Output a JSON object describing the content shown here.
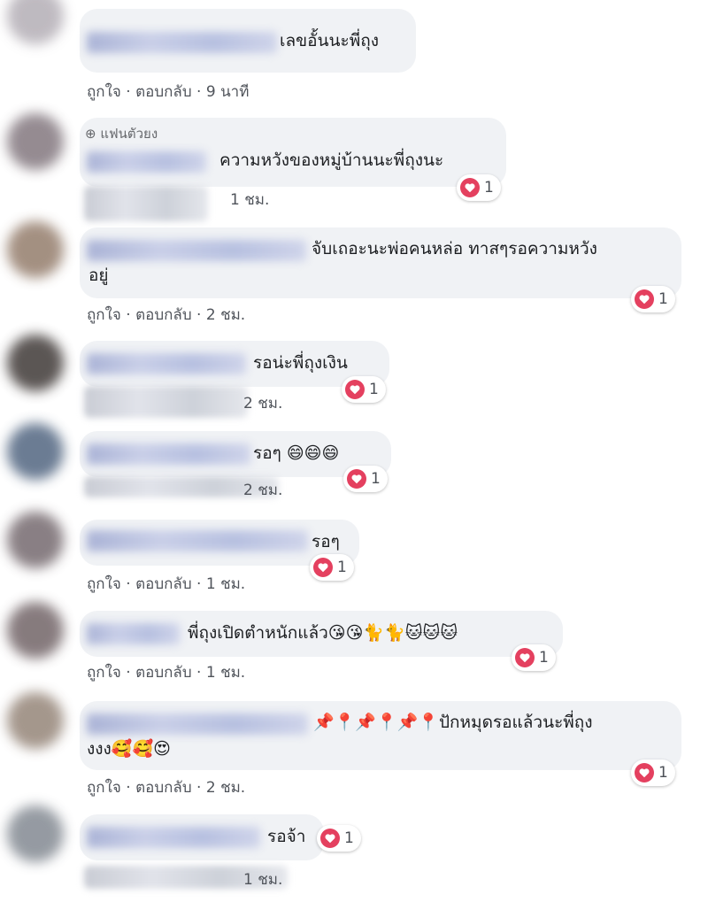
{
  "actions": {
    "like": "ถูกใจ",
    "reply": "ตอบกลับ",
    "sep": " · "
  },
  "comments": [
    {
      "text": "เลขอั้นนะพี่ถุง",
      "time": "9 นาที"
    },
    {
      "badge": "⊕ แฟนตัวยง",
      "text": "ความหวังของหมู่บ้านนะพี่ถุงนะ",
      "reactions": "1",
      "time": "1 ชม."
    },
    {
      "text": "จับเถอะนะพ่อคนหล่อ ทาสๆรอความหวัง",
      "text2": "อยู่",
      "reactions": "1",
      "time": "2 ชม."
    },
    {
      "text": "รอน่ะพี่ถุงเงิน",
      "reactions": "1",
      "time": "2 ชม."
    },
    {
      "text": "รอๆ",
      "emoji": "😄😄😄",
      "reactions": "1",
      "time": "2 ชม."
    },
    {
      "text": "รอๆ",
      "reactions": "1",
      "time": "1 ชม."
    },
    {
      "text": "พี่ถุงเปิดตำหนักแล้ว",
      "emoji": "😘😘🐈🐈🐱🐱🐱",
      "reactions": "1",
      "time": "1 ชม."
    },
    {
      "emoji_pre": "📌📍📌📍📌📍",
      "text": "ปักหมุดรอแล้วนะพี่ถุง",
      "text2": "งงง",
      "emoji2": "🥰🥰😍",
      "reactions": "1",
      "time": "2 ชม."
    },
    {
      "text": "รอจ้า",
      "reactions": "1",
      "time": "1 ชม."
    }
  ],
  "colors": {
    "bubble": "#f0f2f5",
    "heart": "#e4405f",
    "meta": "#50545b"
  },
  "icons": {
    "reaction": "heart-icon"
  }
}
